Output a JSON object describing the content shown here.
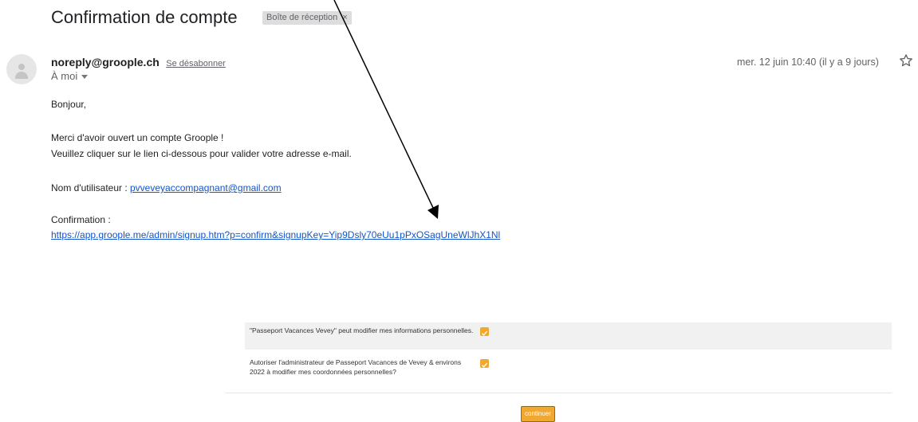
{
  "email": {
    "subject": "Confirmation de compte",
    "label": "Boîte de réception",
    "label_close": "×",
    "sender": "noreply@groople.ch",
    "unsubscribe": "Se désabonner",
    "to_me": "À moi",
    "date": "mer. 12 juin 10:40 (il y a 9 jours)",
    "icons": [
      "avatar-icon",
      "caret-down-icon",
      "star-icon"
    ]
  },
  "body": {
    "greeting": "Bonjour,",
    "line1": "Merci d'avoir ouvert un compte Groople !",
    "line2": "Veuillez cliquer sur le lien ci-dessous pour valider votre adresse e-mail.",
    "username_label": "Nom d'utilisateur : ",
    "username_value": "pvveveyaccompagnant@gmail.com",
    "confirmation_label": "Confirmation :",
    "confirmation_link": "https://app.groople.me/admin/signup.htm?p=confirm&signupKey=Yip9Dsly70eUu1pPxOSagUneWlJhX1Nl"
  },
  "consent": {
    "rows": [
      {
        "text": "\"Passeport Vacances Vevey\" peut modifier mes informations personnelles.",
        "checked": true
      },
      {
        "text": "Autoriser l'administrateur de Passeport Vacances de Vevey & environs 2022 à modifier mes coordonnées personnelles?",
        "checked": true
      }
    ],
    "continue_label": "continuer"
  },
  "colors": {
    "link": "#1155cc",
    "checkbox": "#f0a830",
    "row_shade": "#f1f1f1",
    "arrow": "#000000"
  }
}
